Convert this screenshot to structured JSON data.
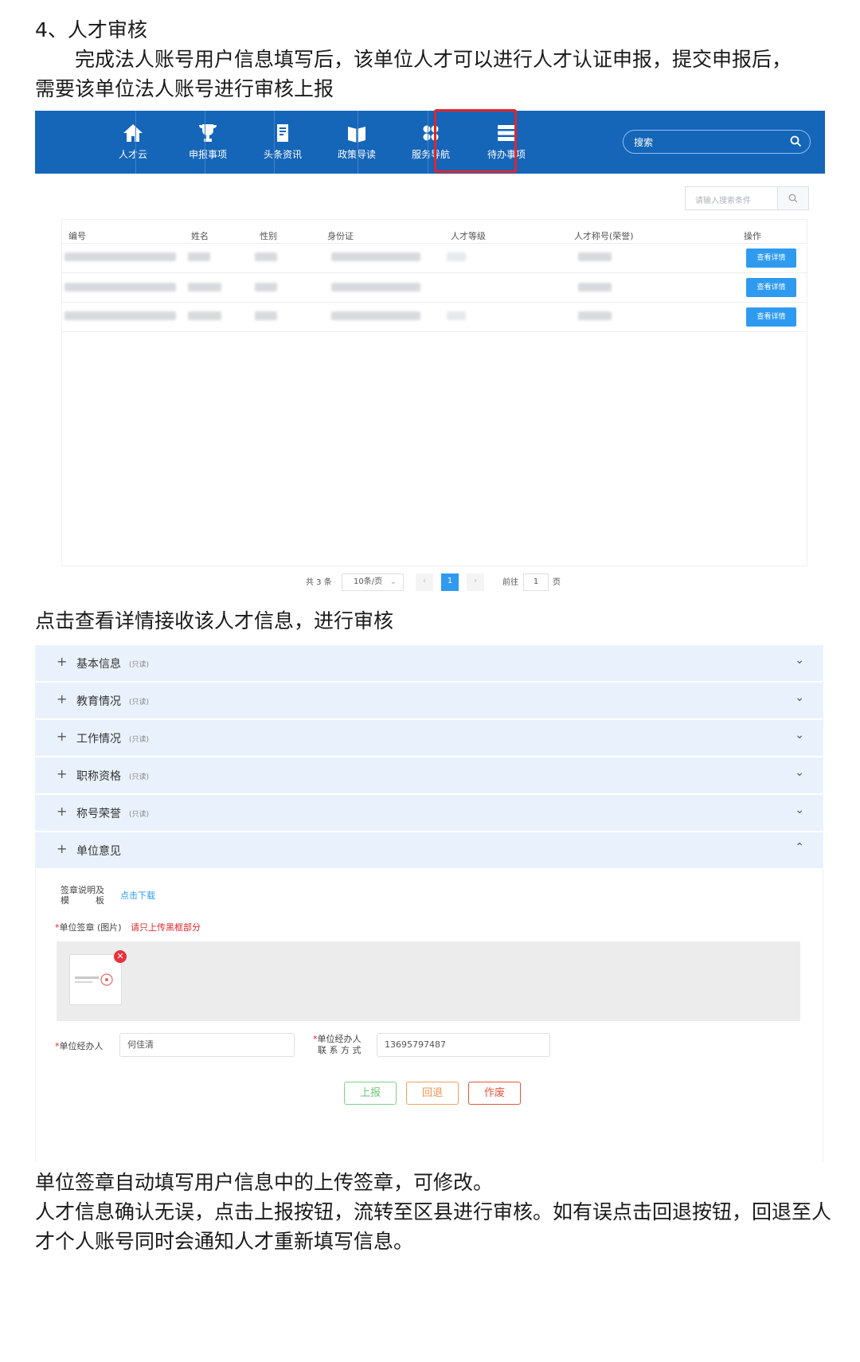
{
  "heading": "4、人才审核",
  "intro_line1": "完成法人账号用户信息填写后，该单位人才可以进行人才认证申报，提交申报后，",
  "intro_line2": "需要该单位法人账号进行审核上报",
  "nav": {
    "items": [
      {
        "label": "人才云",
        "icon": "home-icon"
      },
      {
        "label": "申报事项",
        "icon": "trophy-icon"
      },
      {
        "label": "头条资讯",
        "icon": "document-icon"
      },
      {
        "label": "政策导读",
        "icon": "book-icon"
      },
      {
        "label": "服务导航",
        "icon": "grid-icon"
      },
      {
        "label": "待办事项",
        "icon": "list-icon"
      }
    ],
    "search_label": "搜索",
    "highlight_color": "#e0262b",
    "bar_color": "#1565b8"
  },
  "table": {
    "search_placeholder": "请输入搜索条件",
    "columns": [
      "编号",
      "姓名",
      "性别",
      "身份证",
      "人才等级",
      "人才称号(荣誉)",
      "操作"
    ],
    "action_label": "查看详情",
    "row_count": 3
  },
  "pagination": {
    "total": "共 3 条",
    "page_size": "10条/页",
    "current": "1",
    "goto_prefix": "前往",
    "goto_value": "1",
    "goto_suffix": "页"
  },
  "mid_text": "点击查看详情接收该人才信息，进行审核",
  "sections": [
    {
      "title": "基本信息",
      "note": "(只读)"
    },
    {
      "title": "教育情况",
      "note": "(只读)"
    },
    {
      "title": "工作情况",
      "note": "(只读)"
    },
    {
      "title": "职称资格",
      "note": "(只读)"
    },
    {
      "title": "称号荣誉",
      "note": "(只读)"
    },
    {
      "title": "单位意见",
      "note": ""
    }
  ],
  "form": {
    "template_label_1": "签章说明及",
    "template_label_2": "模　　　板",
    "template_link": "点击下载",
    "seal_label": "单位签章 (图片)",
    "seal_hint": "请只上传黑框部分",
    "handler_label": "单位经办人",
    "handler_value": "何佳清",
    "contact_label_1": "单位经办人",
    "contact_label_2": "联 系 方 式",
    "contact_value": "13695797487",
    "buttons": {
      "submit": "上报",
      "back": "回退",
      "void": "作废"
    }
  },
  "outro_line1": "单位签章自动填写用户信息中的上传签章，可修改。",
  "outro_line2": "人才信息确认无误，点击上报按钮，流转至区县进行审核。如有误点击回退按钮，回退至人",
  "outro_line3": "才个人账号同时会通知人才重新填写信息。"
}
